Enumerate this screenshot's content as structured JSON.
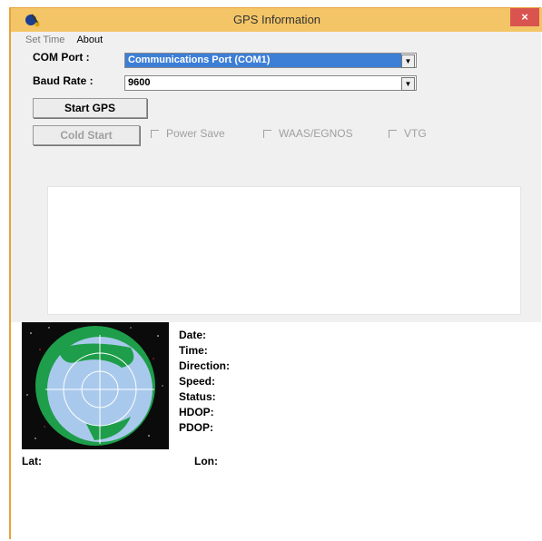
{
  "window": {
    "title": "GPS Information",
    "close_symbol": "×"
  },
  "menu": [
    {
      "label": "Set Time"
    },
    {
      "label": "About"
    }
  ],
  "com_port": {
    "label": "COM Port :",
    "value": "Communications Port (COM1)"
  },
  "baud_rate": {
    "label": "Baud Rate :",
    "value": "9600"
  },
  "buttons": {
    "start_gps": "Start GPS",
    "cold_start": "Cold Start"
  },
  "checkboxes": [
    {
      "label": "Power Save"
    },
    {
      "label": "WAAS/EGNOS"
    },
    {
      "label": "VTG"
    }
  ],
  "info_fields": [
    "Date:",
    "Time:",
    "Direction:",
    "Speed:",
    "Status:",
    "HDOP:",
    "PDOP:"
  ],
  "coordinates": {
    "lat": "Lat:",
    "lon": "Lon:"
  }
}
